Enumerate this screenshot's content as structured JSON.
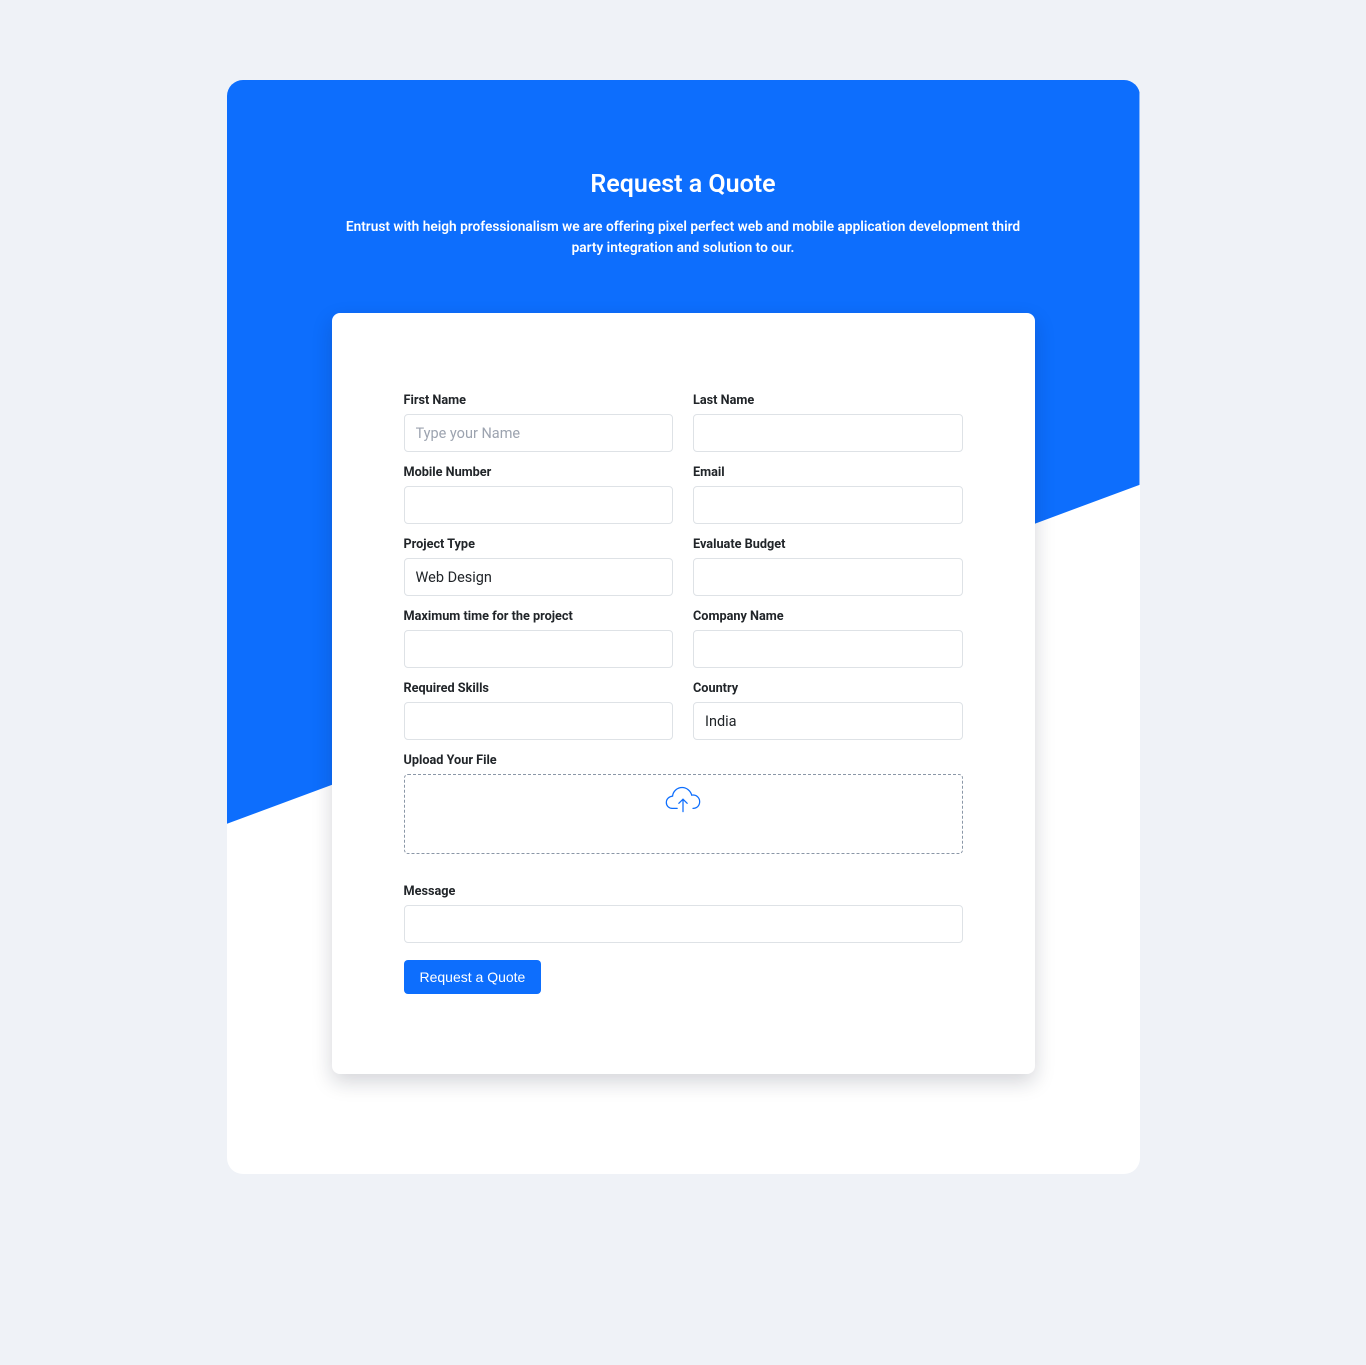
{
  "header": {
    "title": "Request a Quote",
    "subtitle": "Entrust with heigh professionalism we are offering pixel perfect web and mobile application development third party integration and solution to our."
  },
  "form": {
    "firstName": {
      "label": "First Name",
      "placeholder": "Type your Name"
    },
    "lastName": {
      "label": "Last Name"
    },
    "mobile": {
      "label": "Mobile Number"
    },
    "email": {
      "label": "Email"
    },
    "projectType": {
      "label": "Project Type",
      "value": "Web Design"
    },
    "budget": {
      "label": "Evaluate Budget"
    },
    "maxTime": {
      "label": "Maximum time for the project"
    },
    "company": {
      "label": "Company Name"
    },
    "skills": {
      "label": "Required Skills"
    },
    "country": {
      "label": "Country",
      "value": "India"
    },
    "upload": {
      "label": "Upload Your File"
    },
    "message": {
      "label": "Message"
    },
    "submit": "Request a Quote"
  }
}
